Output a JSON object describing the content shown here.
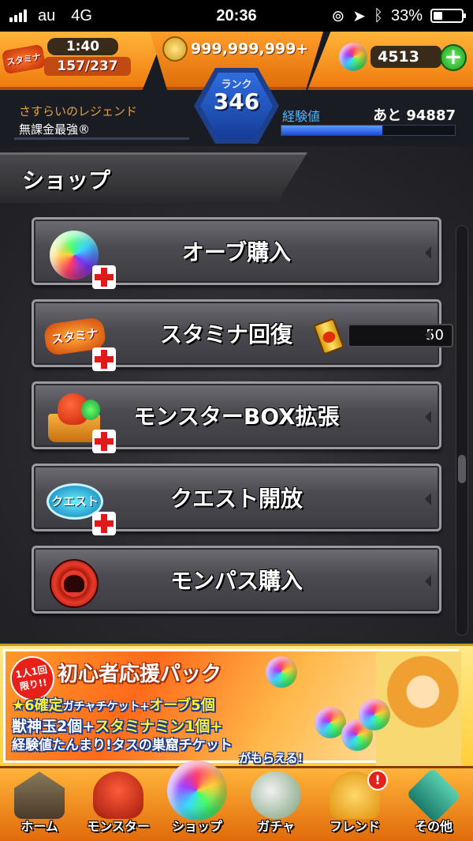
{
  "status_bar": {
    "carrier": "au",
    "network": "4G",
    "time": "20:36",
    "battery": "33%",
    "battery_level": 0.33
  },
  "header": {
    "stamina_badge": "スタミナ",
    "stamina_timer": "1:40",
    "stamina_count": "157/237",
    "coins": "999,999,999+",
    "orbs": "4513",
    "plus_label": "+",
    "rank_label": "ランク",
    "rank_value": "346",
    "title_top": "さすらいのレジェンド",
    "title_bottom": "無課金最強®",
    "exp_label": "経験値",
    "exp_next": "あと 94887",
    "exp_progress": 0.58,
    "accent_color": "#f08a18"
  },
  "shop": {
    "title": "ショップ",
    "items": [
      {
        "label": "オーブ購入",
        "icon": "orb-icon"
      },
      {
        "label": "スタミナ回復",
        "icon": "stamina-icon",
        "icon_text": "スタミナ",
        "extra_value": "50",
        "extra_icon": "stamina-can-icon"
      },
      {
        "label": "モンスターBOX拡張",
        "icon": "monster-box-icon"
      },
      {
        "label": "クエスト開放",
        "icon": "quest-icon",
        "icon_text": "クエスト"
      },
      {
        "label": "モンパス購入",
        "icon": "monpass-icon"
      }
    ]
  },
  "banner": {
    "limit": "1人1回限り!!",
    "title": "初心者応援パック",
    "line1_a": "★6確定",
    "line1_b": "ガチャチケット+",
    "line1_c": "オーブ5個",
    "line2_a": "獣神玉2個+",
    "line2_b": "スタミナミン1個+",
    "line3": "経験値たんまり!タスの巣窟チケット",
    "line4": "がもらえる!"
  },
  "bottom_nav": [
    {
      "label": "ホーム",
      "icon": "home-icon"
    },
    {
      "label": "モンスター",
      "icon": "monster-icon"
    },
    {
      "label": "ショップ",
      "icon": "shop-orb-icon"
    },
    {
      "label": "ガチャ",
      "icon": "gacha-egg-icon"
    },
    {
      "label": "フレンド",
      "icon": "friend-icon",
      "badge": "!"
    },
    {
      "label": "その他",
      "icon": "other-icon"
    }
  ]
}
